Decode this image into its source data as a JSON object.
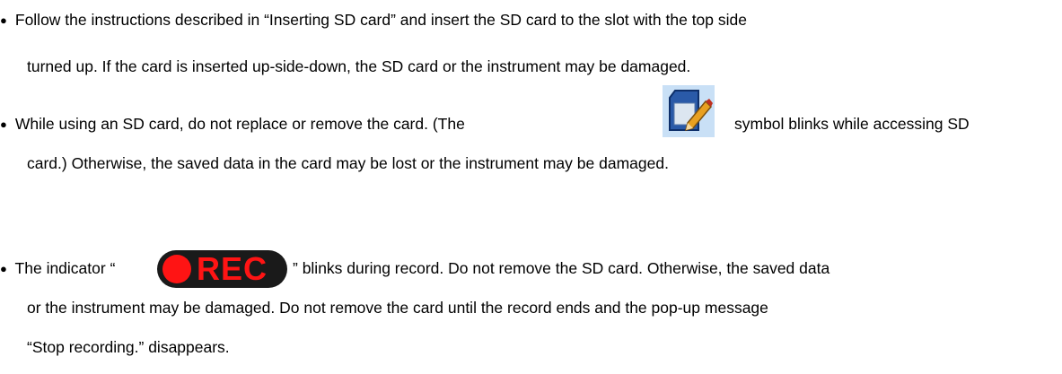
{
  "bullet": "●",
  "items": [
    {
      "lines": [
        "Follow the instructions described in “Inserting SD card” and insert the SD card to the slot with the top side",
        "turned up. If the card is inserted up-side-down, the SD card or the instrument may be damaged."
      ]
    },
    {
      "line1_before": "While using an SD card, do not replace or remove the card. (The",
      "line1_after": "symbol blinks while accessing SD",
      "line2": "card.) Otherwise, the saved data in the card may be lost or the instrument may be damaged.",
      "icon": "sd-card-edit-icon",
      "icon_colors": {
        "background": "#c9e0f6",
        "card": "#2a5aa8",
        "pencil": "#e8a020"
      }
    },
    {
      "line1_before": "The indicator “",
      "line1_after": "” blinks during record. Do not remove the SD card. Otherwise, the saved data",
      "lines": [
        "or the instrument may be damaged. Do not remove the card until the record ends and the pop-up message",
        "“Stop recording.” disappears."
      ],
      "indicator": {
        "icon": "rec-indicator-icon",
        "label": "REC",
        "color": "#ff1414",
        "background": "#1a1a1a"
      }
    }
  ]
}
